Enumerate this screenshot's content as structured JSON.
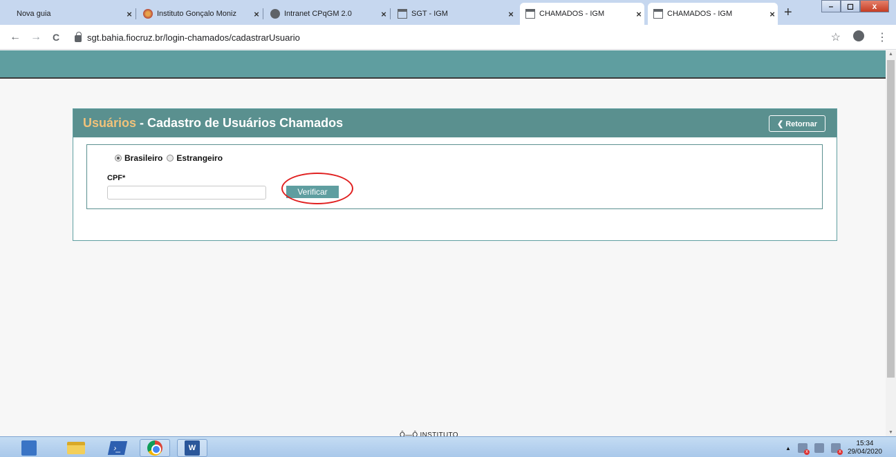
{
  "browser": {
    "tabs": [
      {
        "title": "Nova guia",
        "favicon": "blank-page-icon"
      },
      {
        "title": "Instituto Gonçalo Moniz",
        "favicon": "igm-logo-icon"
      },
      {
        "title": "Intranet CPqGM 2.0",
        "favicon": "globe-icon"
      },
      {
        "title": "SGT - IGM",
        "favicon": "page-icon"
      },
      {
        "title": "CHAMADOS - IGM",
        "favicon": "page-icon"
      },
      {
        "title": "CHAMADOS - IGM",
        "favicon": "page-icon"
      }
    ],
    "close_glyph": "×",
    "new_tab_glyph": "+",
    "url": "sgt.bahia.fiocruz.br/login-chamados/cadastrarUsuario",
    "back_glyph": "←",
    "forward_glyph": "→",
    "reload_glyph": "C",
    "star_glyph": "☆",
    "menu_glyph": "⋮",
    "window_controls": {
      "minimize": "–",
      "maximize": "◻",
      "close": "x"
    }
  },
  "page": {
    "panel_title_prefix": "Usuários",
    "panel_title_rest": " - Cadastro de Usuários Chamados",
    "retornar_label": "❮ Retornar",
    "radio_brasileiro": "Brasileiro",
    "radio_estrangeiro": "Estrangeiro",
    "selected_nationality": "Brasileiro",
    "cpf_label": "CPF*",
    "cpf_value": "",
    "verificar_label": "Verificar",
    "footer_text": "Ô—Ô INSTITUTO",
    "colors": {
      "header": "#5f9ea0",
      "panel_header": "#5a908f",
      "title_accent": "#f0c27a",
      "highlight": "#e02020"
    }
  },
  "taskbar": {
    "items": [
      "start-icon",
      "file-explorer-icon",
      "powershell-icon",
      "chrome-icon",
      "word-icon"
    ],
    "word_letter": "W",
    "ps_glyph": "›_",
    "tray_arrow": "▲",
    "time": "15:34",
    "date": "29/04/2020"
  }
}
